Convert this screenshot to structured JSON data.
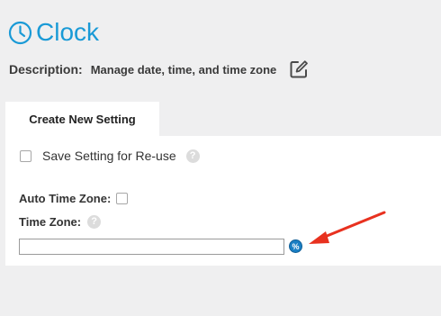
{
  "header": {
    "title": "Clock",
    "icon": "clock-icon",
    "accent_color": "#1a9ad6"
  },
  "description": {
    "label": "Description:",
    "value": "Manage date, time, and time zone",
    "edit_icon": "edit-icon"
  },
  "tabs": [
    {
      "label": "Create New Setting",
      "active": true
    }
  ],
  "form": {
    "save_setting": {
      "label": "Save Setting for Re-use",
      "checked": false,
      "help_glyph": "?"
    },
    "auto_time_zone": {
      "label": "Auto Time Zone:",
      "checked": false
    },
    "time_zone": {
      "label": "Time Zone:",
      "help_glyph": "?",
      "value": "",
      "placeholder": "",
      "variable_button_glyph": "%"
    }
  },
  "annotation": {
    "arrow_color": "#e8311f"
  }
}
